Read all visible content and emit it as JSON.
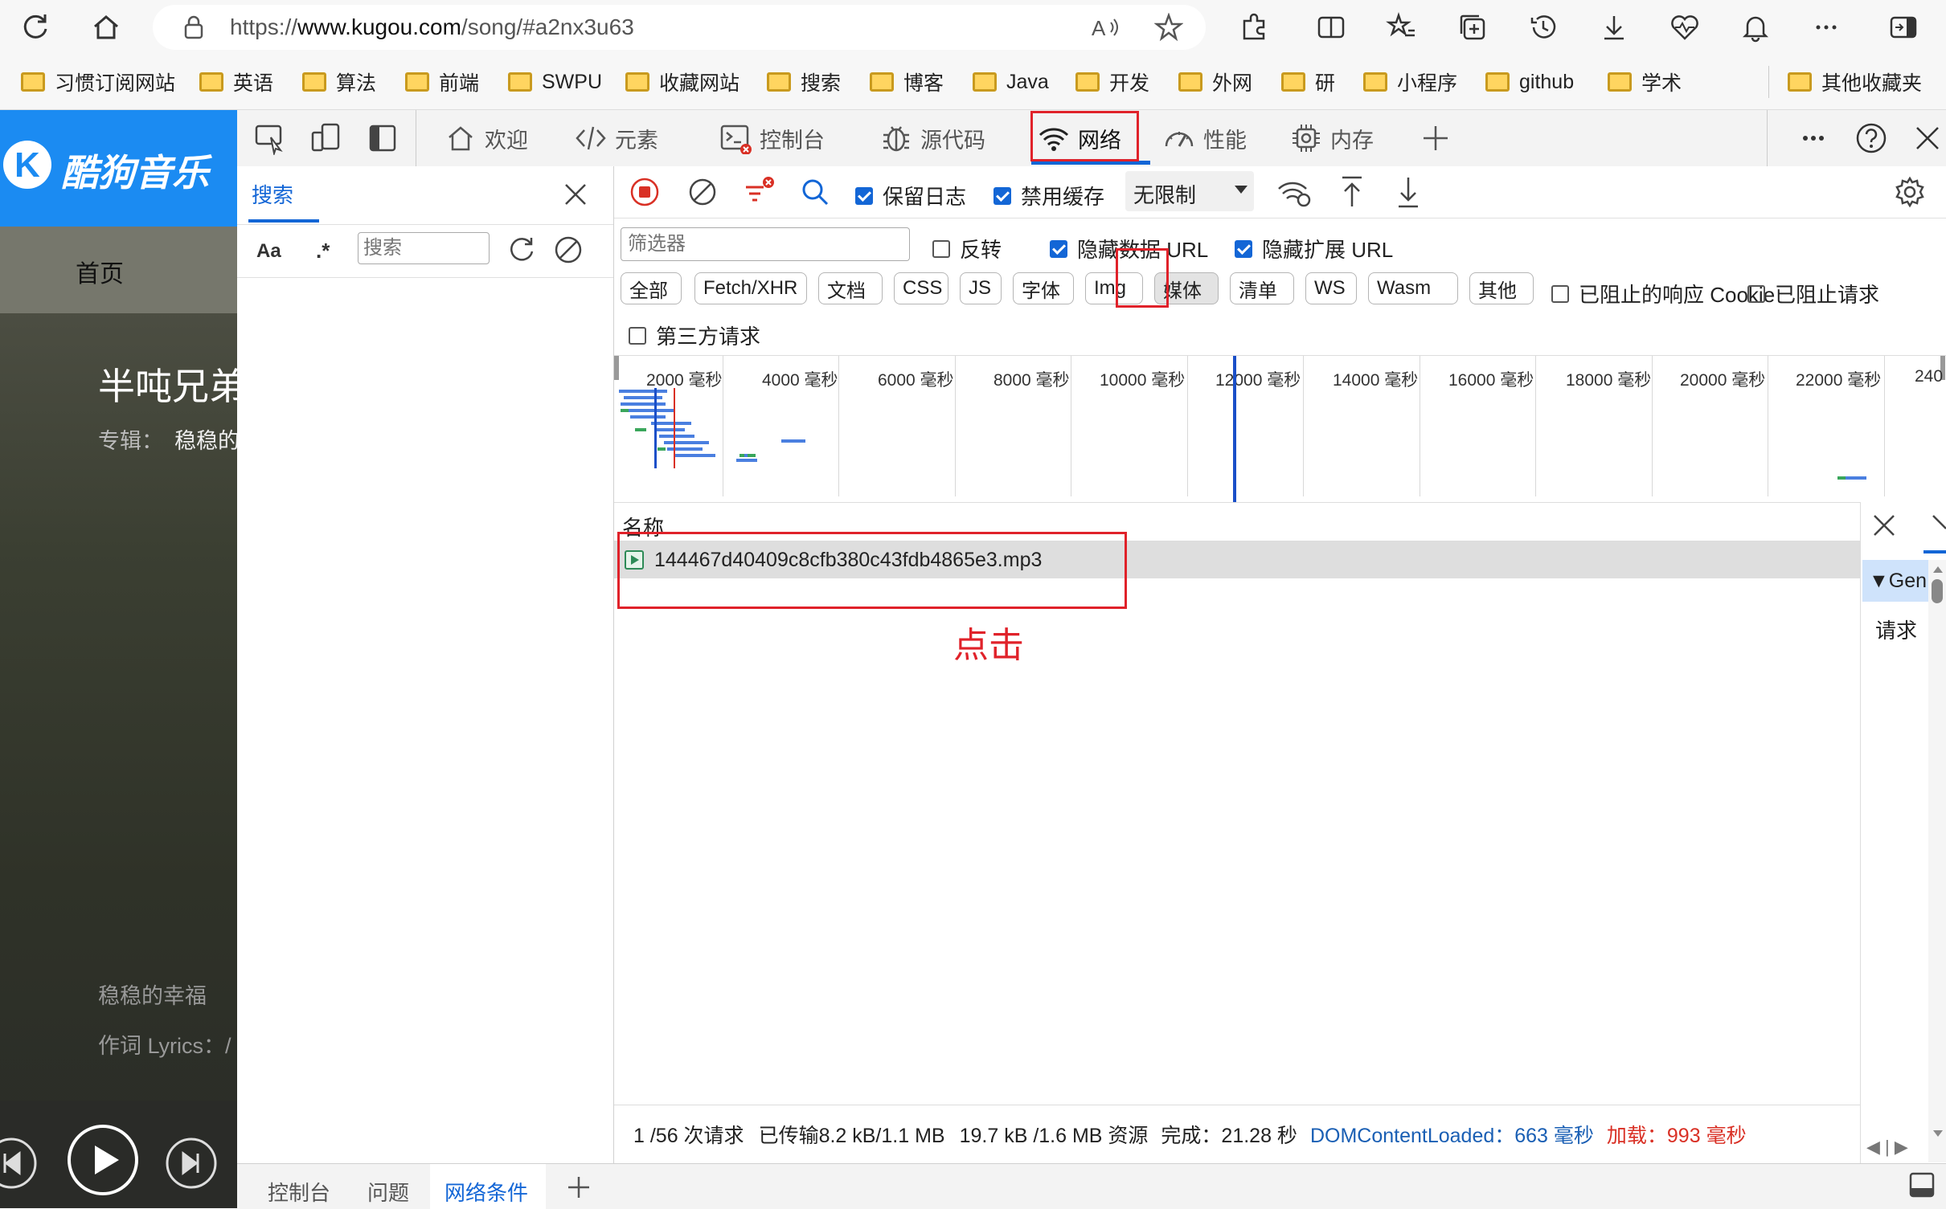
{
  "browser": {
    "url_prefix": "https://",
    "url_host": "www.kugou.com",
    "url_path": "/song/#a2nx3u63",
    "bookmarks": [
      "习惯订阅网站",
      "英语",
      "算法",
      "前端",
      "SWPU",
      "收藏网站",
      "搜索",
      "博客",
      "Java",
      "开发",
      "外网",
      "研",
      "小程序",
      "github",
      "学术"
    ],
    "other_bookmarks": "其他收藏夹"
  },
  "site": {
    "logo_text": "酷狗音乐",
    "home": "首页",
    "song_title": "半吨兄弟",
    "album_label": "专辑：",
    "album_value": "稳稳的",
    "lyric_line1": "稳稳的幸福",
    "lyric_line2": "作词 Lyrics：/"
  },
  "devtools": {
    "tabs": [
      "欢迎",
      "元素",
      "控制台",
      "源代码",
      "网络",
      "性能",
      "内存"
    ],
    "active_tab": "网络",
    "search_pane": {
      "tab": "搜索",
      "case_label": "Aa",
      "regex_label": ".*",
      "placeholder": "搜索"
    },
    "toolbar": {
      "preserve_log": "保留日志",
      "disable_cache": "禁用缓存",
      "throttle": "无限制"
    },
    "filter": {
      "placeholder": "筛选器",
      "invert": "反转",
      "hide_data_url": "隐藏数据 URL",
      "hide_ext_url": "隐藏扩展 URL"
    },
    "types": [
      "全部",
      "Fetch/XHR",
      "文档",
      "CSS",
      "JS",
      "字体",
      "Img",
      "媒体",
      "清单",
      "WS",
      "Wasm",
      "其他"
    ],
    "blocked_cookie": "已阻止的响应 Cookie",
    "blocked_requests": "已阻止请求",
    "third_party": "第三方请求",
    "overview_ticks": [
      "2000 毫秒",
      "4000 毫秒",
      "6000 毫秒",
      "8000 毫秒",
      "10000 毫秒",
      "12000 毫秒",
      "14000 毫秒",
      "16000 毫秒",
      "18000 毫秒",
      "20000 毫秒",
      "22000 毫秒",
      "240"
    ],
    "column_name": "名称",
    "request_row": "144467d40409c8cfb380c43fdb4865e3.mp3",
    "annotation": "点击",
    "detail": {
      "general": "▼Gen",
      "request": "请求"
    },
    "status": {
      "requests": "1 /56 次请求",
      "transferred": "已传输8.2 kB/1.1 MB",
      "resources": "19.7 kB /1.6 MB 资源",
      "finish": "完成：21.28 秒",
      "dcl": "DOMContentLoaded：663 毫秒",
      "load": "加载：993 毫秒"
    },
    "drawer_tabs": [
      "控制台",
      "问题",
      "网络条件"
    ],
    "active_drawer_tab": "网络条件"
  },
  "colors": {
    "accent": "#1366d6",
    "kugou_blue": "#1b8bf2",
    "annotation_red": "#e0222a",
    "load_red": "#d93025",
    "dcl_blue": "#1a5fb4"
  }
}
